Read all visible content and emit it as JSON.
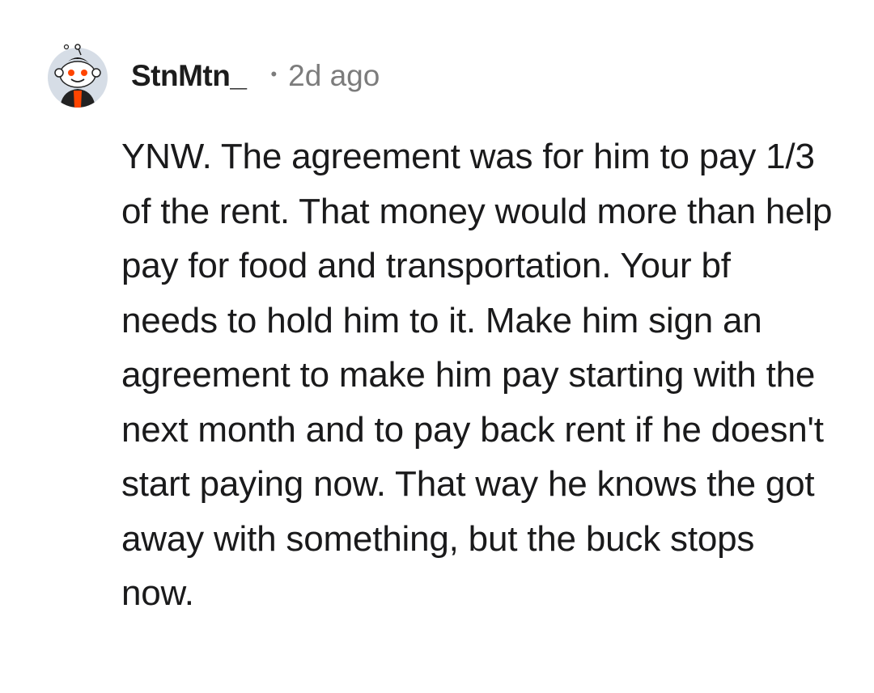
{
  "comment": {
    "author": "StnMtn_",
    "separator": "•",
    "age": "2d ago",
    "avatar_icon": "snoo-avatar-icon",
    "body": "YNW. The agreement was for him to pay 1/3 of the rent. That money would more than help pay for food and transportation. Your bf needs to hold him to it. Make him sign an agreement to make him pay starting with the next month and to pay back rent if he doesn't start paying now. That way he knows the got away with something, but the buck stops now."
  },
  "colors": {
    "username": "#1c1c1c",
    "meta": "#7c7c7c",
    "body_text": "#1a1a1b",
    "avatar_accent": "#ff4500"
  }
}
